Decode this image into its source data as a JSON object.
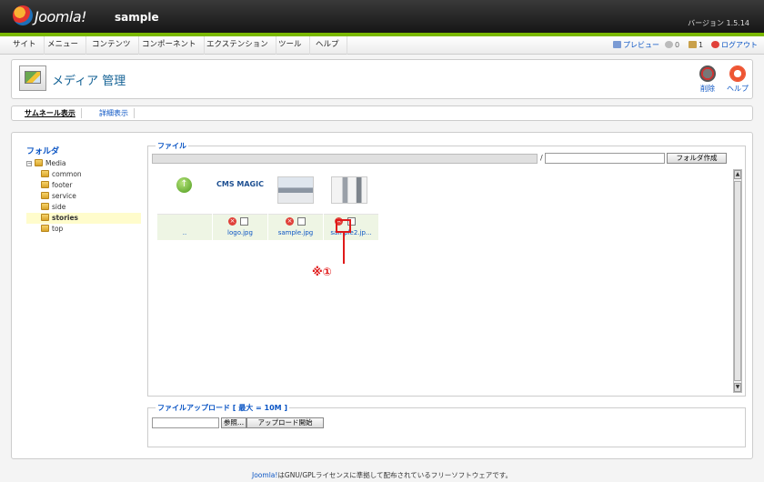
{
  "header": {
    "brand": "Joomla!",
    "site_name": "sample",
    "version": "バージョン 1.5.14"
  },
  "menu": {
    "items": [
      "サイト",
      "メニュー",
      "コンテンツ",
      "コンポーネント",
      "エクステンション",
      "ツール",
      "ヘルプ"
    ],
    "preview": "プレビュー",
    "messages_count": "0",
    "users_count": "1",
    "logout": "ログアウト"
  },
  "toolbar": {
    "title": "メディア 管理",
    "delete_label": "削除",
    "help_label": "ヘルプ"
  },
  "submenu": {
    "thumbnail_view": "サムネール表示",
    "detail_view": "詳細表示"
  },
  "folders": {
    "label": "フォルダ",
    "root": "Media",
    "children": [
      "common",
      "footer",
      "service",
      "side",
      "stories",
      "top"
    ],
    "selected": "stories"
  },
  "files": {
    "legend": "ファイル",
    "path_separator": "/",
    "folder_name_value": "",
    "create_folder_button": "フォルダ作成",
    "up_label": "..",
    "items": [
      {
        "name": "logo.jpg",
        "thumb_text": "CMS MAGIC"
      },
      {
        "name": "sample.jpg",
        "thumb_text": ""
      },
      {
        "name": "sample2.jp...",
        "thumb_text": ""
      }
    ]
  },
  "upload": {
    "legend": "ファイルアップロード [ 最大 = 10M ]",
    "browse_button": "参照...",
    "start_button": "アップロード開始"
  },
  "annotation": {
    "label": "※①",
    "color": "#e01a1a"
  },
  "footer": {
    "link": "Joomla!",
    "text": "はGNU/GPLライセンスに準拠して配布されているフリーソフトウェアです。"
  }
}
